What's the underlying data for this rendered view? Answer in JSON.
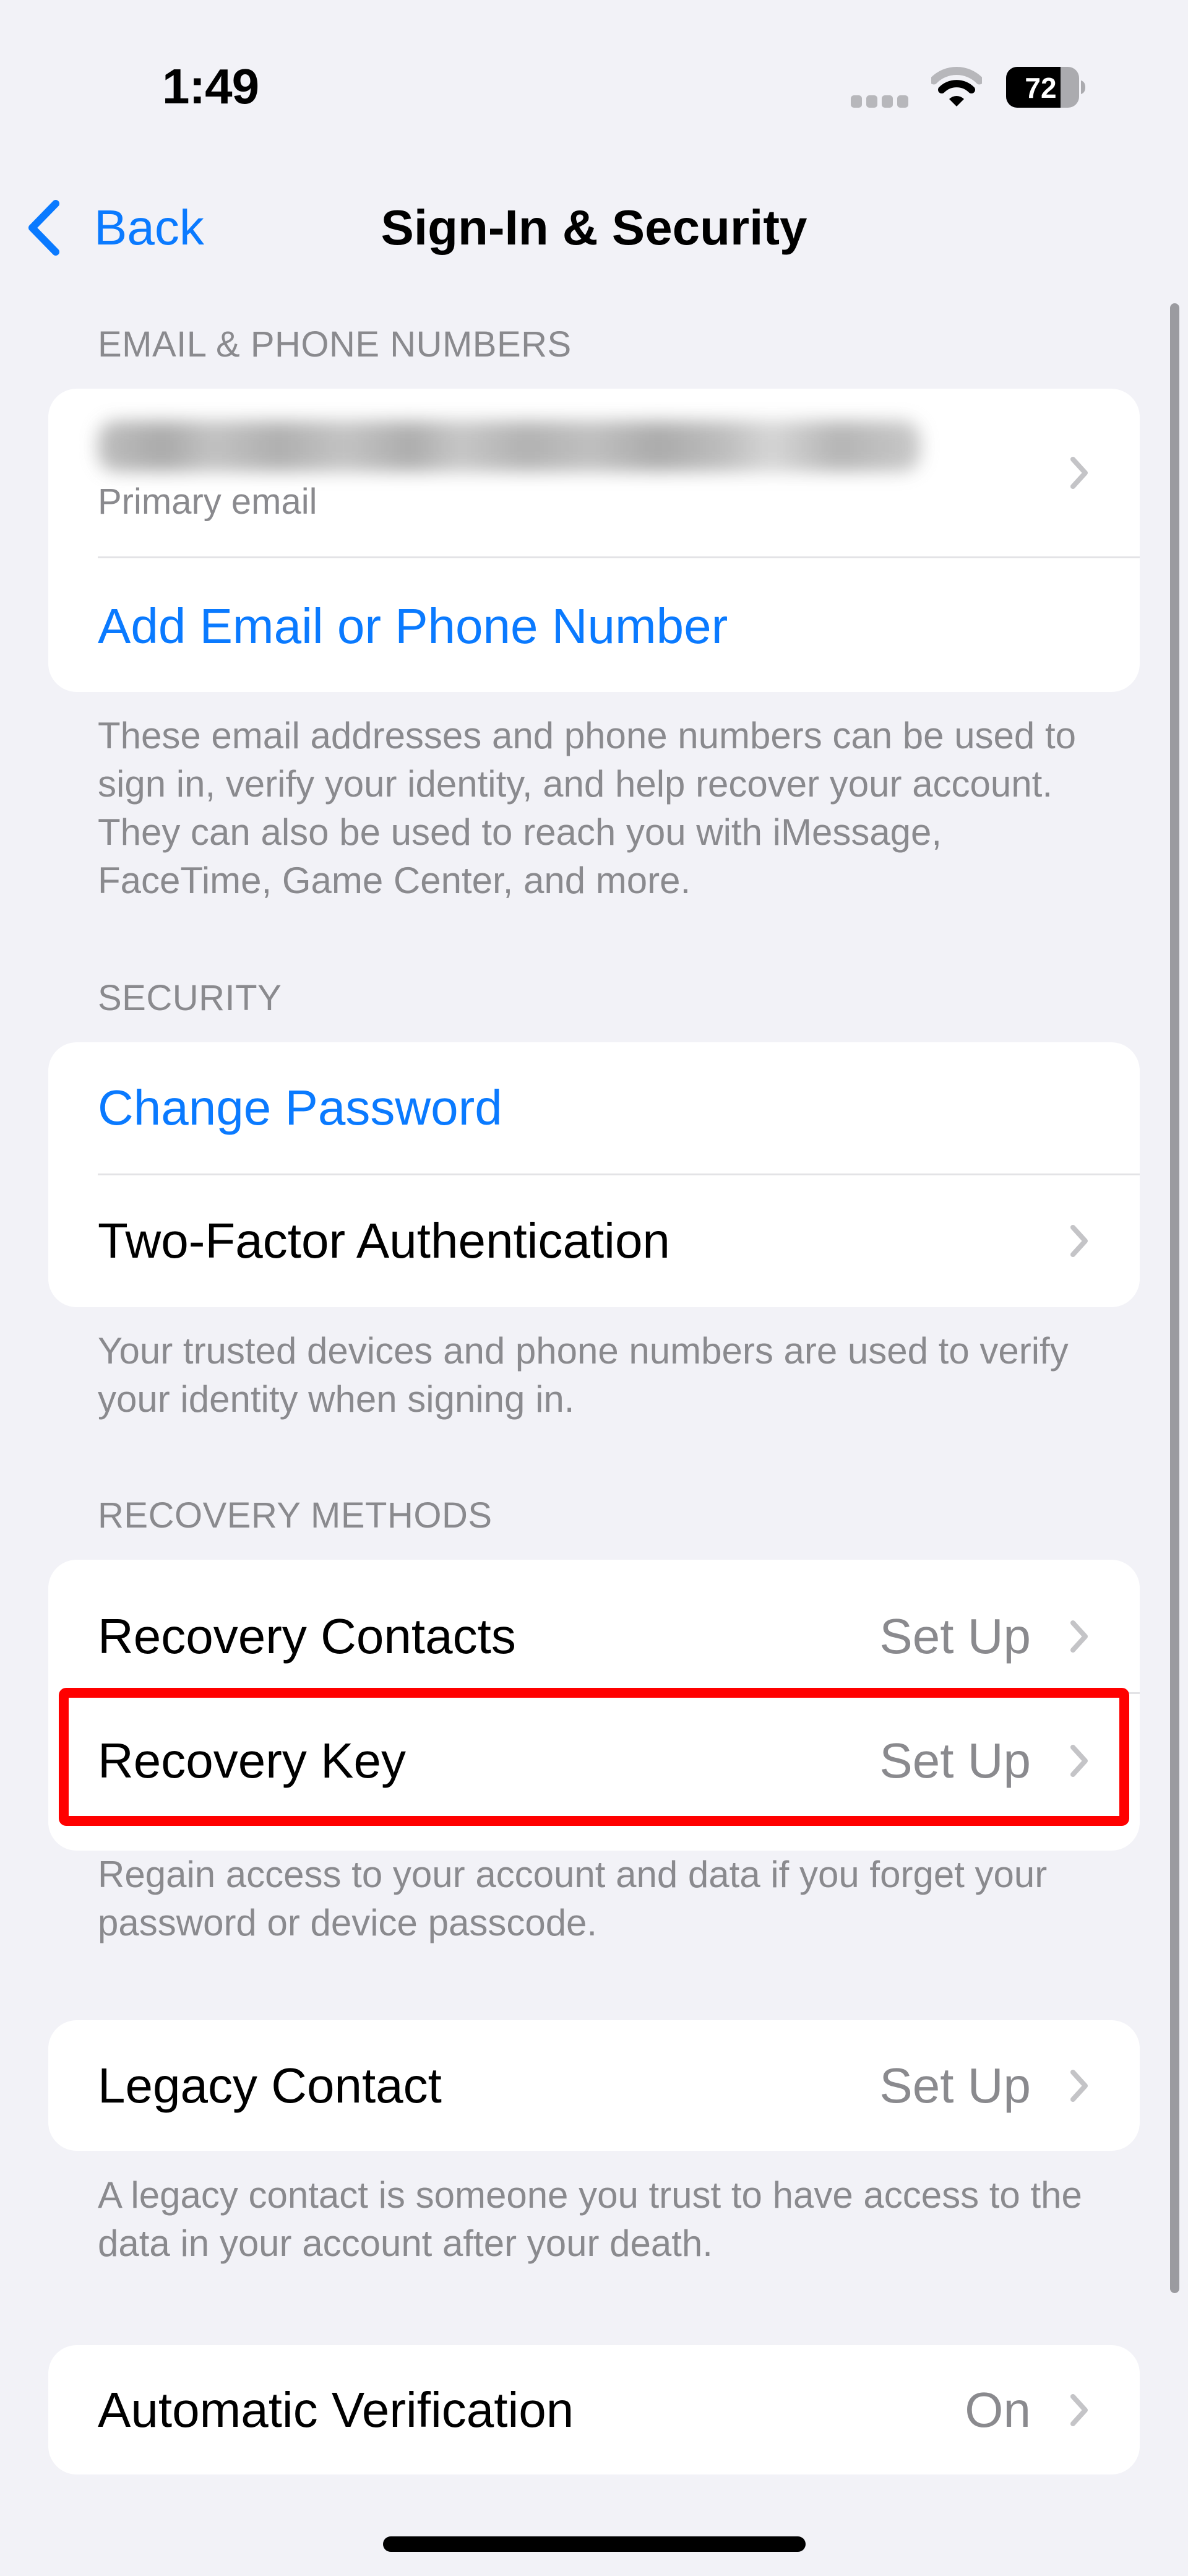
{
  "status_bar": {
    "time": "1:49",
    "cellular_icon": "no-service-dots-icon",
    "wifi_icon": "wifi-icon",
    "battery_percent": "72",
    "battery_level": 0.72
  },
  "nav": {
    "back_label": "Back",
    "back_icon": "chevron-left-icon",
    "title": "Sign-In & Security"
  },
  "colors": {
    "accent": "#0A7AFF",
    "background": "#F2F2F7",
    "card": "#FFFFFF",
    "secondary_text": "#8A8A8E",
    "chevron": "#C4C4C7",
    "highlight": "#FF0000"
  },
  "sections": {
    "email": {
      "header": "EMAIL & PHONE NUMBERS",
      "primary_email_value": "[redacted – blurred]",
      "primary_email_sublabel": "Primary email",
      "add_label": "Add Email or Phone Number",
      "footnote": "These email addresses and phone numbers can be used to sign in, verify your identity, and help recover your account. They can also be used to reach you with iMessage, FaceTime, Game Center, and more."
    },
    "security": {
      "header": "SECURITY",
      "change_password_label": "Change Password",
      "two_factor_label": "Two-Factor Authentication",
      "footnote": "Your trusted devices and phone numbers are used to verify your identity when signing in."
    },
    "recovery": {
      "header": "RECOVERY METHODS",
      "contacts_label": "Recovery Contacts",
      "contacts_value": "Set Up",
      "key_label": "Recovery Key",
      "key_value": "Set Up",
      "footnote": "Regain access to your account and data if you forget your password or device passcode."
    },
    "legacy": {
      "label": "Legacy Contact",
      "value": "Set Up",
      "footnote": "A legacy contact is someone you trust to have access to the data in your account after your death."
    },
    "verification": {
      "label": "Automatic Verification",
      "value": "On"
    }
  },
  "annotation": {
    "highlighted_item": "Recovery Key"
  }
}
